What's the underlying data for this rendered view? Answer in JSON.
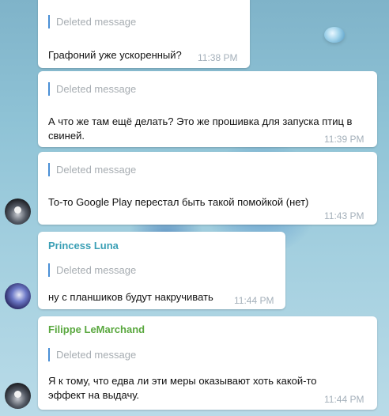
{
  "messages": [
    {
      "quote": "Deleted message",
      "text": "Графоний уже ускоренный?",
      "time": "11:38 PM"
    },
    {
      "quote": "Deleted message",
      "text": "А что же там ещё делать? Это же прошивка для запуска птиц в свиней.",
      "time": "11:39 PM"
    },
    {
      "quote": "Deleted message",
      "text": "То-то Google Play перестал быть такой помойкой (нет)",
      "time": "11:43 PM"
    },
    {
      "author": "Princess Luna",
      "author_color": "#3a9fb5",
      "quote": "Deleted message",
      "text": "ну с планшиков будут накручивать",
      "time": "11:44 PM"
    },
    {
      "author": "Filippe LeMarchand",
      "author_color": "#5aa83f",
      "quote": "Deleted message",
      "text": "Я к тому, что едва ли эти меры оказывают хоть какой-то эффект на выдачу.",
      "time": "11:44 PM"
    }
  ],
  "avatars": [
    {
      "icon": "penguin-avatar"
    },
    {
      "icon": "princess-luna-avatar"
    },
    {
      "icon": "penguin-avatar"
    }
  ]
}
